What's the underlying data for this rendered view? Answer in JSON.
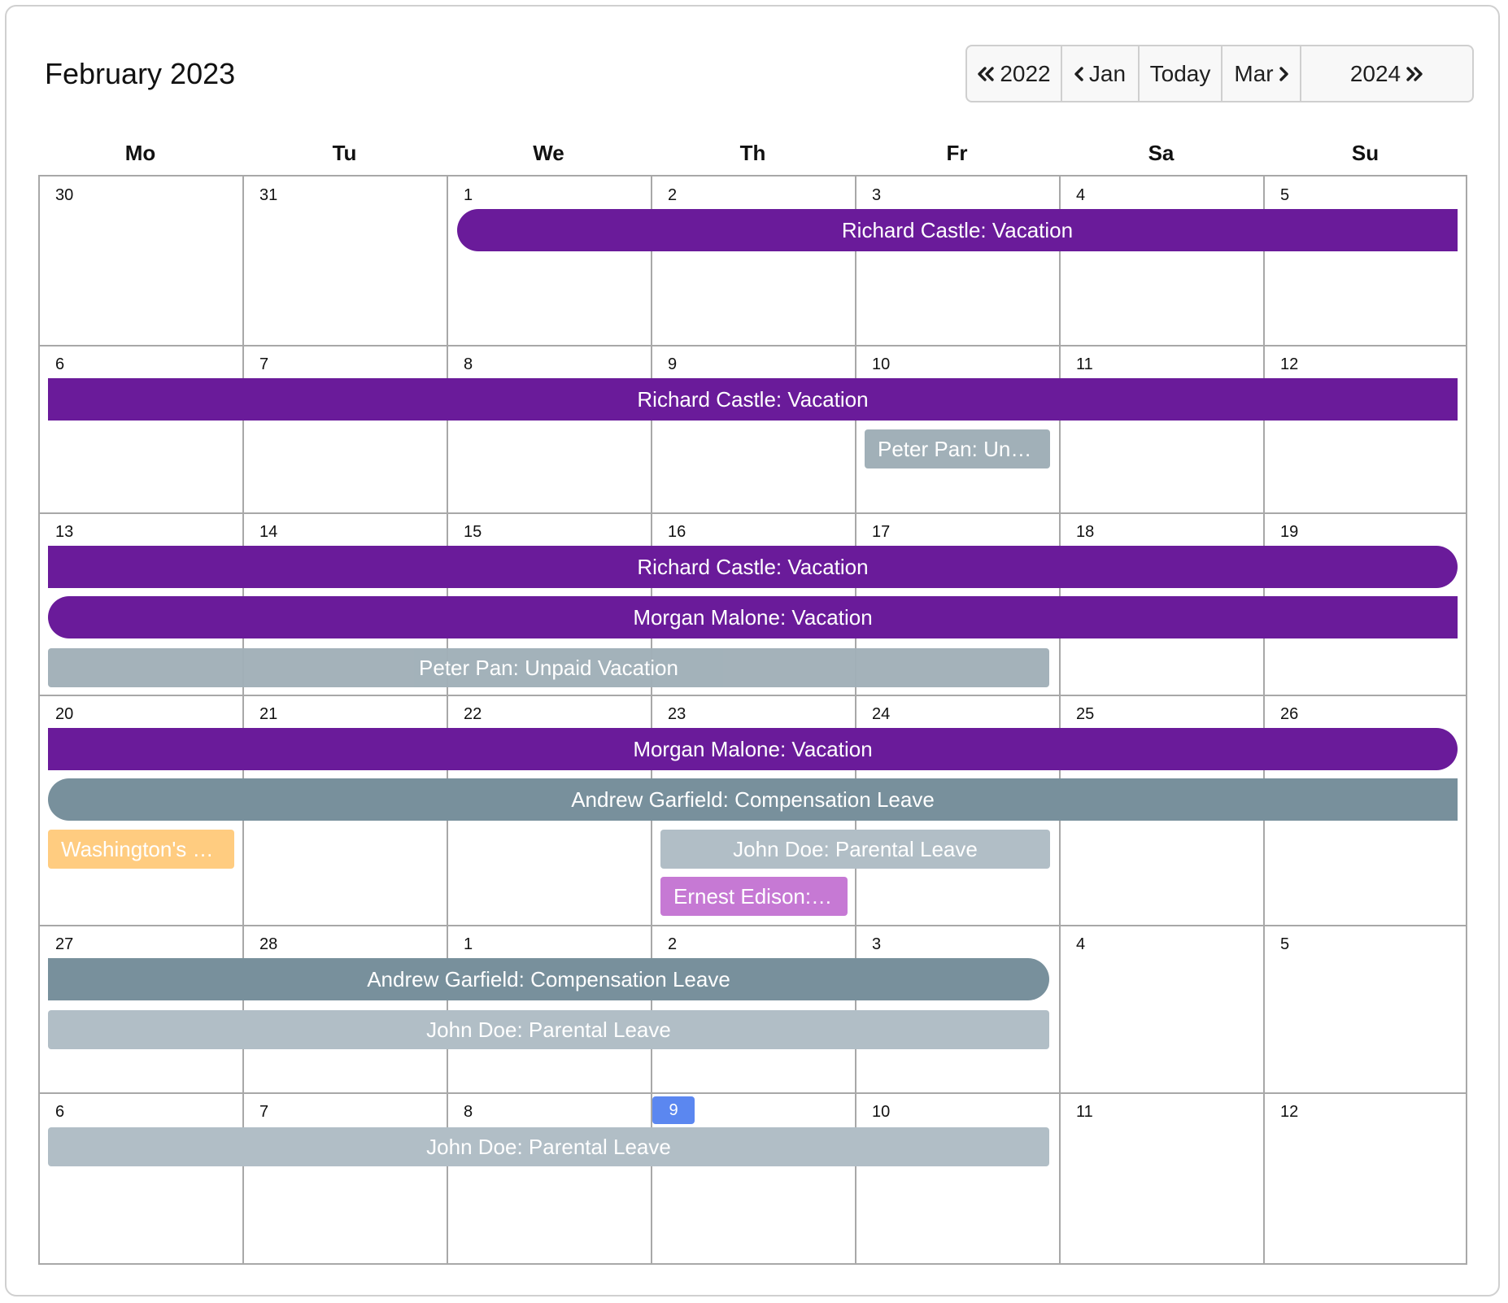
{
  "header": {
    "title": "February 2023"
  },
  "nav": {
    "prev_year": "2022",
    "prev_month": "Jan",
    "today": "Today",
    "next_month": "Mar",
    "next_year": "2024"
  },
  "weekdays": [
    "Mo",
    "Tu",
    "We",
    "Th",
    "Fr",
    "Sa",
    "Su"
  ],
  "weeks": [
    [
      "30",
      "31",
      "1",
      "2",
      "3",
      "4",
      "5"
    ],
    [
      "6",
      "7",
      "8",
      "9",
      "10",
      "11",
      "12"
    ],
    [
      "13",
      "14",
      "15",
      "16",
      "17",
      "18",
      "19"
    ],
    [
      "20",
      "21",
      "22",
      "23",
      "24",
      "25",
      "26"
    ],
    [
      "27",
      "28",
      "1",
      "2",
      "3",
      "4",
      "5"
    ],
    [
      "6",
      "7",
      "8",
      "9",
      "10",
      "11",
      "12"
    ]
  ],
  "today": {
    "week": 5,
    "day": 3
  },
  "events": [
    {
      "label": "Richard Castle: Vacation",
      "color": "#6a1b9a",
      "week": 0
    },
    {
      "label": "Richard Castle: Vacation",
      "color": "#6a1b9a",
      "week": 1
    },
    {
      "label": "Peter Pan: Unp…",
      "color": "#a1b0b8",
      "week": 1
    },
    {
      "label": "Richard Castle: Vacation",
      "color": "#6a1b9a",
      "week": 2
    },
    {
      "label": "Morgan Malone: Vacation",
      "color": "#6a1b9a",
      "week": 2
    },
    {
      "label": "Peter Pan: Unpaid Vacation",
      "color": "#a1b0b8",
      "week": 2
    },
    {
      "label": "Morgan Malone: Vacation",
      "color": "#6a1b9a",
      "week": 3
    },
    {
      "label": "Andrew Garfield: Compensation Leave",
      "color": "#78909c",
      "week": 3
    },
    {
      "label": "Washington's B…",
      "color": "#ffcc80",
      "week": 3
    },
    {
      "label": "John Doe: Parental Leave",
      "color": "#b1bec6",
      "week": 3
    },
    {
      "label": "Ernest Edison: …",
      "color": "#c679d4",
      "week": 3
    },
    {
      "label": "Andrew Garfield: Compensation Leave",
      "color": "#78909c",
      "week": 4
    },
    {
      "label": "John Doe: Parental Leave",
      "color": "#b1bec6",
      "week": 4
    },
    {
      "label": "John Doe: Parental Leave",
      "color": "#b1bec6",
      "week": 5
    }
  ]
}
